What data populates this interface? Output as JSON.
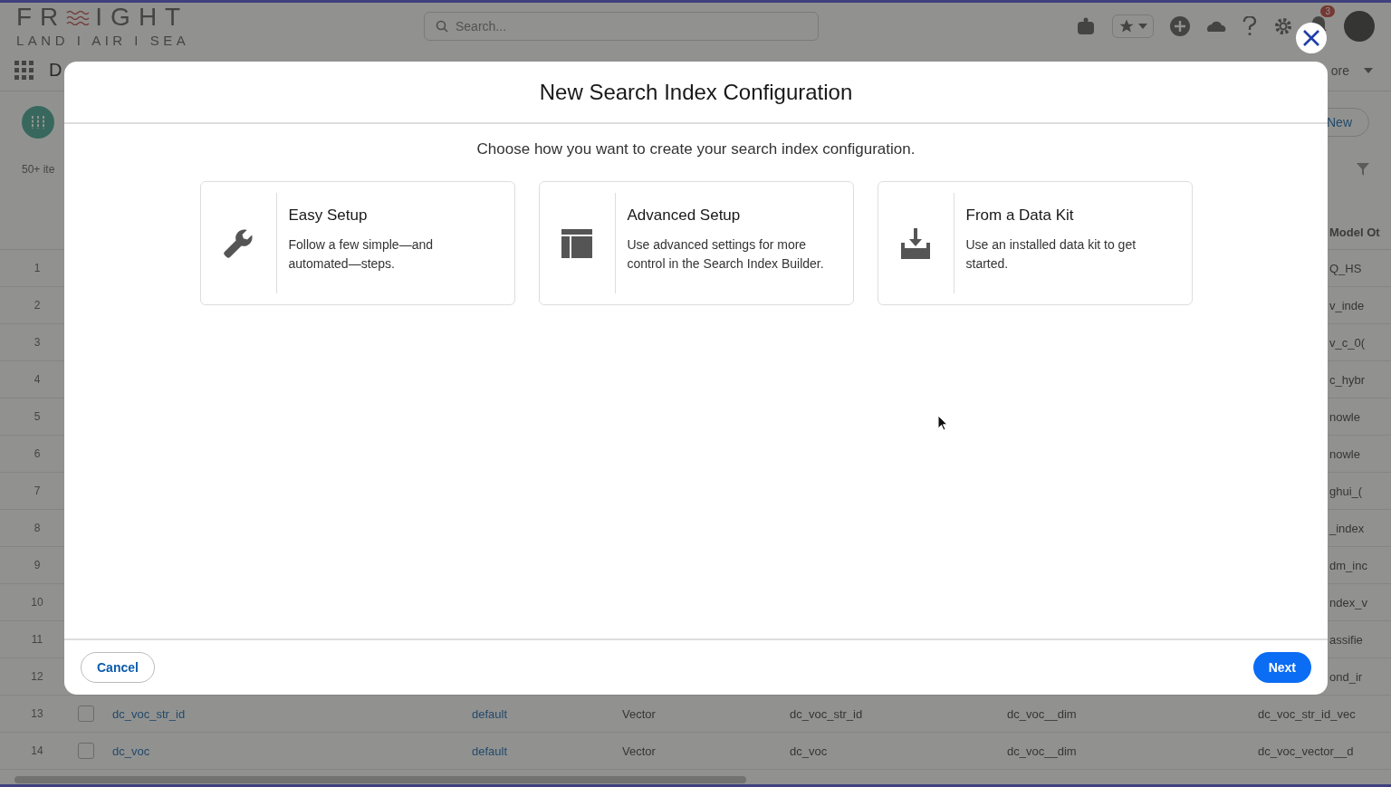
{
  "header": {
    "logo": {
      "left": "FR",
      "right": "IGHT",
      "tagline": "LAND I AIR I SEA"
    },
    "search": {
      "placeholder": "Search..."
    },
    "notification_count": "3"
  },
  "nav": {
    "title": "D",
    "more": "ore"
  },
  "list": {
    "new_button": "New",
    "count": "50+ ite",
    "column_header": "Model Ot",
    "rows": [
      {
        "kind": "partial",
        "number": "1",
        "tail": "Q_HS"
      },
      {
        "kind": "partial",
        "number": "2",
        "tail": "v_inde"
      },
      {
        "kind": "partial",
        "number": "3",
        "tail": "v_c_0("
      },
      {
        "kind": "partial",
        "number": "4",
        "tail": "c_hybr"
      },
      {
        "kind": "partial",
        "number": "5",
        "tail": "nowle"
      },
      {
        "kind": "partial",
        "number": "6",
        "tail": "nowle"
      },
      {
        "kind": "partial",
        "number": "7",
        "tail": "ghui_("
      },
      {
        "kind": "partial",
        "number": "8",
        "tail": "_index"
      },
      {
        "kind": "partial",
        "number": "9",
        "tail": "dm_inc"
      },
      {
        "kind": "partial",
        "number": "10",
        "tail": "ndex_v"
      },
      {
        "kind": "partial",
        "number": "11",
        "tail": "assifie"
      },
      {
        "kind": "partial",
        "number": "12",
        "tail": "ond_ir"
      },
      {
        "kind": "full",
        "number": "13",
        "checked": false,
        "cells": [
          "dc_voc_str_id",
          "default",
          "Vector",
          "dc_voc_str_id",
          "dc_voc__dim",
          "dc_voc_str_id_vec"
        ]
      },
      {
        "kind": "full",
        "number": "14",
        "checked": false,
        "cells": [
          "dc_voc",
          "default",
          "Vector",
          "dc_voc",
          "dc_voc__dim",
          "dc_voc_vector__d"
        ]
      }
    ]
  },
  "modal": {
    "title": "New Search Index Configuration",
    "subtitle": "Choose how you want to create your search index configuration.",
    "options": [
      {
        "title": "Easy Setup",
        "description": "Follow a few simple—and automated—steps."
      },
      {
        "title": "Advanced Setup",
        "description": "Use advanced settings for more control in the Search Index Builder."
      },
      {
        "title": "From a Data Kit",
        "description": "Use an installed data kit to get started."
      }
    ],
    "cancel": "Cancel",
    "next": "Next"
  }
}
